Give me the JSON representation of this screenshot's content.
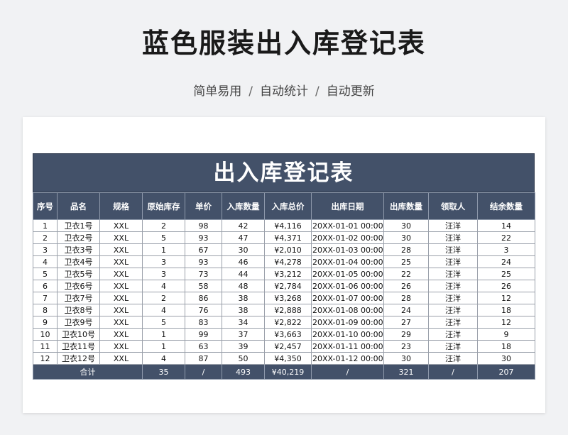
{
  "page": {
    "title": "蓝色服装出入库登记表",
    "subtitle": [
      "简单易用",
      "自动统计",
      "自动更新"
    ],
    "separator": "/"
  },
  "sheet": {
    "title": "出入库登记表",
    "headers": [
      "序号",
      "品名",
      "规格",
      "原始库存",
      "单价",
      "入库数量",
      "入库总价",
      "出库日期",
      "出库数量",
      "领取人",
      "结余数量"
    ],
    "rows": [
      [
        "1",
        "卫衣1号",
        "XXL",
        "2",
        "98",
        "42",
        "¥4,116",
        "20XX-01-01 00:00:00",
        "30",
        "汪洋",
        "14"
      ],
      [
        "2",
        "卫衣2号",
        "XXL",
        "5",
        "93",
        "47",
        "¥4,371",
        "20XX-01-02 00:00:00",
        "30",
        "汪洋",
        "22"
      ],
      [
        "3",
        "卫衣3号",
        "XXL",
        "1",
        "67",
        "30",
        "¥2,010",
        "20XX-01-03 00:00:00",
        "28",
        "汪洋",
        "3"
      ],
      [
        "4",
        "卫衣4号",
        "XXL",
        "3",
        "93",
        "46",
        "¥4,278",
        "20XX-01-04 00:00:00",
        "25",
        "汪洋",
        "24"
      ],
      [
        "5",
        "卫衣5号",
        "XXL",
        "3",
        "73",
        "44",
        "¥3,212",
        "20XX-01-05 00:00:00",
        "22",
        "汪洋",
        "25"
      ],
      [
        "6",
        "卫衣6号",
        "XXL",
        "4",
        "58",
        "48",
        "¥2,784",
        "20XX-01-06 00:00:00",
        "26",
        "汪洋",
        "26"
      ],
      [
        "7",
        "卫衣7号",
        "XXL",
        "2",
        "86",
        "38",
        "¥3,268",
        "20XX-01-07 00:00:00",
        "28",
        "汪洋",
        "12"
      ],
      [
        "8",
        "卫衣8号",
        "XXL",
        "4",
        "76",
        "38",
        "¥2,888",
        "20XX-01-08 00:00:00",
        "24",
        "汪洋",
        "18"
      ],
      [
        "9",
        "卫衣9号",
        "XXL",
        "5",
        "83",
        "34",
        "¥2,822",
        "20XX-01-09 00:00:00",
        "27",
        "汪洋",
        "12"
      ],
      [
        "10",
        "卫衣10号",
        "XXL",
        "1",
        "99",
        "37",
        "¥3,663",
        "20XX-01-10 00:00:00",
        "29",
        "汪洋",
        "9"
      ],
      [
        "11",
        "卫衣11号",
        "XXL",
        "1",
        "63",
        "39",
        "¥2,457",
        "20XX-01-11 00:00:00",
        "23",
        "汪洋",
        "18"
      ],
      [
        "12",
        "卫衣12号",
        "XXL",
        "4",
        "87",
        "50",
        "¥4,350",
        "20XX-01-12 00:00:00",
        "30",
        "汪洋",
        "30"
      ]
    ],
    "total": {
      "label": "合计",
      "original_stock": "35",
      "unit_price": "/",
      "in_qty": "493",
      "in_total": "¥40,219",
      "out_date": "/",
      "out_qty": "321",
      "receiver": "/",
      "balance": "207"
    }
  },
  "colors": {
    "header_bg": "#435169",
    "page_bg": "#f1f2f4"
  }
}
